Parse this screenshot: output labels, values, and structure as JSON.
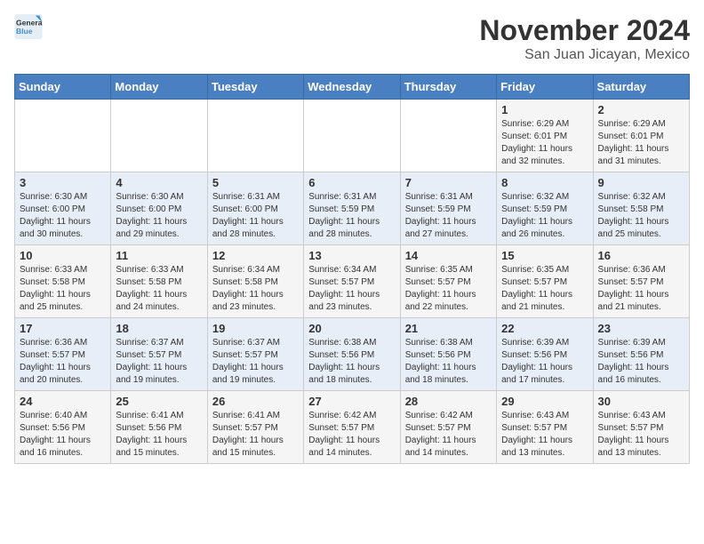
{
  "logo": {
    "text_general": "General",
    "text_blue": "Blue"
  },
  "title": "November 2024",
  "subtitle": "San Juan Jicayan, Mexico",
  "headers": [
    "Sunday",
    "Monday",
    "Tuesday",
    "Wednesday",
    "Thursday",
    "Friday",
    "Saturday"
  ],
  "weeks": [
    [
      {
        "day": "",
        "info": ""
      },
      {
        "day": "",
        "info": ""
      },
      {
        "day": "",
        "info": ""
      },
      {
        "day": "",
        "info": ""
      },
      {
        "day": "",
        "info": ""
      },
      {
        "day": "1",
        "info": "Sunrise: 6:29 AM\nSunset: 6:01 PM\nDaylight: 11 hours\nand 32 minutes."
      },
      {
        "day": "2",
        "info": "Sunrise: 6:29 AM\nSunset: 6:01 PM\nDaylight: 11 hours\nand 31 minutes."
      }
    ],
    [
      {
        "day": "3",
        "info": "Sunrise: 6:30 AM\nSunset: 6:00 PM\nDaylight: 11 hours\nand 30 minutes."
      },
      {
        "day": "4",
        "info": "Sunrise: 6:30 AM\nSunset: 6:00 PM\nDaylight: 11 hours\nand 29 minutes."
      },
      {
        "day": "5",
        "info": "Sunrise: 6:31 AM\nSunset: 6:00 PM\nDaylight: 11 hours\nand 28 minutes."
      },
      {
        "day": "6",
        "info": "Sunrise: 6:31 AM\nSunset: 5:59 PM\nDaylight: 11 hours\nand 28 minutes."
      },
      {
        "day": "7",
        "info": "Sunrise: 6:31 AM\nSunset: 5:59 PM\nDaylight: 11 hours\nand 27 minutes."
      },
      {
        "day": "8",
        "info": "Sunrise: 6:32 AM\nSunset: 5:59 PM\nDaylight: 11 hours\nand 26 minutes."
      },
      {
        "day": "9",
        "info": "Sunrise: 6:32 AM\nSunset: 5:58 PM\nDaylight: 11 hours\nand 25 minutes."
      }
    ],
    [
      {
        "day": "10",
        "info": "Sunrise: 6:33 AM\nSunset: 5:58 PM\nDaylight: 11 hours\nand 25 minutes."
      },
      {
        "day": "11",
        "info": "Sunrise: 6:33 AM\nSunset: 5:58 PM\nDaylight: 11 hours\nand 24 minutes."
      },
      {
        "day": "12",
        "info": "Sunrise: 6:34 AM\nSunset: 5:58 PM\nDaylight: 11 hours\nand 23 minutes."
      },
      {
        "day": "13",
        "info": "Sunrise: 6:34 AM\nSunset: 5:57 PM\nDaylight: 11 hours\nand 23 minutes."
      },
      {
        "day": "14",
        "info": "Sunrise: 6:35 AM\nSunset: 5:57 PM\nDaylight: 11 hours\nand 22 minutes."
      },
      {
        "day": "15",
        "info": "Sunrise: 6:35 AM\nSunset: 5:57 PM\nDaylight: 11 hours\nand 21 minutes."
      },
      {
        "day": "16",
        "info": "Sunrise: 6:36 AM\nSunset: 5:57 PM\nDaylight: 11 hours\nand 21 minutes."
      }
    ],
    [
      {
        "day": "17",
        "info": "Sunrise: 6:36 AM\nSunset: 5:57 PM\nDaylight: 11 hours\nand 20 minutes."
      },
      {
        "day": "18",
        "info": "Sunrise: 6:37 AM\nSunset: 5:57 PM\nDaylight: 11 hours\nand 19 minutes."
      },
      {
        "day": "19",
        "info": "Sunrise: 6:37 AM\nSunset: 5:57 PM\nDaylight: 11 hours\nand 19 minutes."
      },
      {
        "day": "20",
        "info": "Sunrise: 6:38 AM\nSunset: 5:56 PM\nDaylight: 11 hours\nand 18 minutes."
      },
      {
        "day": "21",
        "info": "Sunrise: 6:38 AM\nSunset: 5:56 PM\nDaylight: 11 hours\nand 18 minutes."
      },
      {
        "day": "22",
        "info": "Sunrise: 6:39 AM\nSunset: 5:56 PM\nDaylight: 11 hours\nand 17 minutes."
      },
      {
        "day": "23",
        "info": "Sunrise: 6:39 AM\nSunset: 5:56 PM\nDaylight: 11 hours\nand 16 minutes."
      }
    ],
    [
      {
        "day": "24",
        "info": "Sunrise: 6:40 AM\nSunset: 5:56 PM\nDaylight: 11 hours\nand 16 minutes."
      },
      {
        "day": "25",
        "info": "Sunrise: 6:41 AM\nSunset: 5:56 PM\nDaylight: 11 hours\nand 15 minutes."
      },
      {
        "day": "26",
        "info": "Sunrise: 6:41 AM\nSunset: 5:57 PM\nDaylight: 11 hours\nand 15 minutes."
      },
      {
        "day": "27",
        "info": "Sunrise: 6:42 AM\nSunset: 5:57 PM\nDaylight: 11 hours\nand 14 minutes."
      },
      {
        "day": "28",
        "info": "Sunrise: 6:42 AM\nSunset: 5:57 PM\nDaylight: 11 hours\nand 14 minutes."
      },
      {
        "day": "29",
        "info": "Sunrise: 6:43 AM\nSunset: 5:57 PM\nDaylight: 11 hours\nand 13 minutes."
      },
      {
        "day": "30",
        "info": "Sunrise: 6:43 AM\nSunset: 5:57 PM\nDaylight: 11 hours\nand 13 minutes."
      }
    ]
  ]
}
